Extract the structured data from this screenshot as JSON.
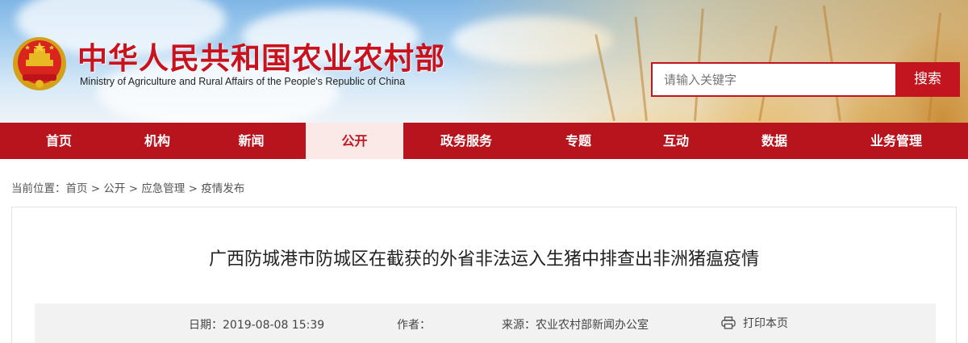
{
  "header": {
    "title_cn": "中华人民共和国农业农村部",
    "title_en": "Ministry of Agriculture  and  Rural  Affairs  of  the People's Republic of China",
    "emblem_icon": "national-emblem-icon"
  },
  "search": {
    "placeholder": "请输入关键字",
    "button_label": "搜索"
  },
  "nav": {
    "items": [
      {
        "label": "首页"
      },
      {
        "label": "机构"
      },
      {
        "label": "新闻"
      },
      {
        "label": "公开"
      },
      {
        "label": "政务服务"
      },
      {
        "label": "专题"
      },
      {
        "label": "互动"
      },
      {
        "label": "数据"
      },
      {
        "label": "业务管理"
      }
    ],
    "active_index": 3
  },
  "breadcrumb": {
    "prefix": "当前位置：",
    "items": [
      "首页",
      "公开",
      "应急管理",
      "疫情发布"
    ],
    "separator": " > "
  },
  "article": {
    "title": "广西防城港市防城区在截获的外省非法运入生猪中排查出非洲猪瘟疫情",
    "date_label": "日期：",
    "date_value": "2019-08-08 15:39",
    "author_label": "作者：",
    "author_value": "",
    "source_label": "来源：",
    "source_value": "农业农村部新闻办公室",
    "print_label": "打印本页",
    "print_icon": "printer-icon"
  },
  "colors": {
    "brand_red": "#c2151f",
    "nav_red": "#b8141d",
    "active_tab_bg": "#fbe9e7"
  }
}
